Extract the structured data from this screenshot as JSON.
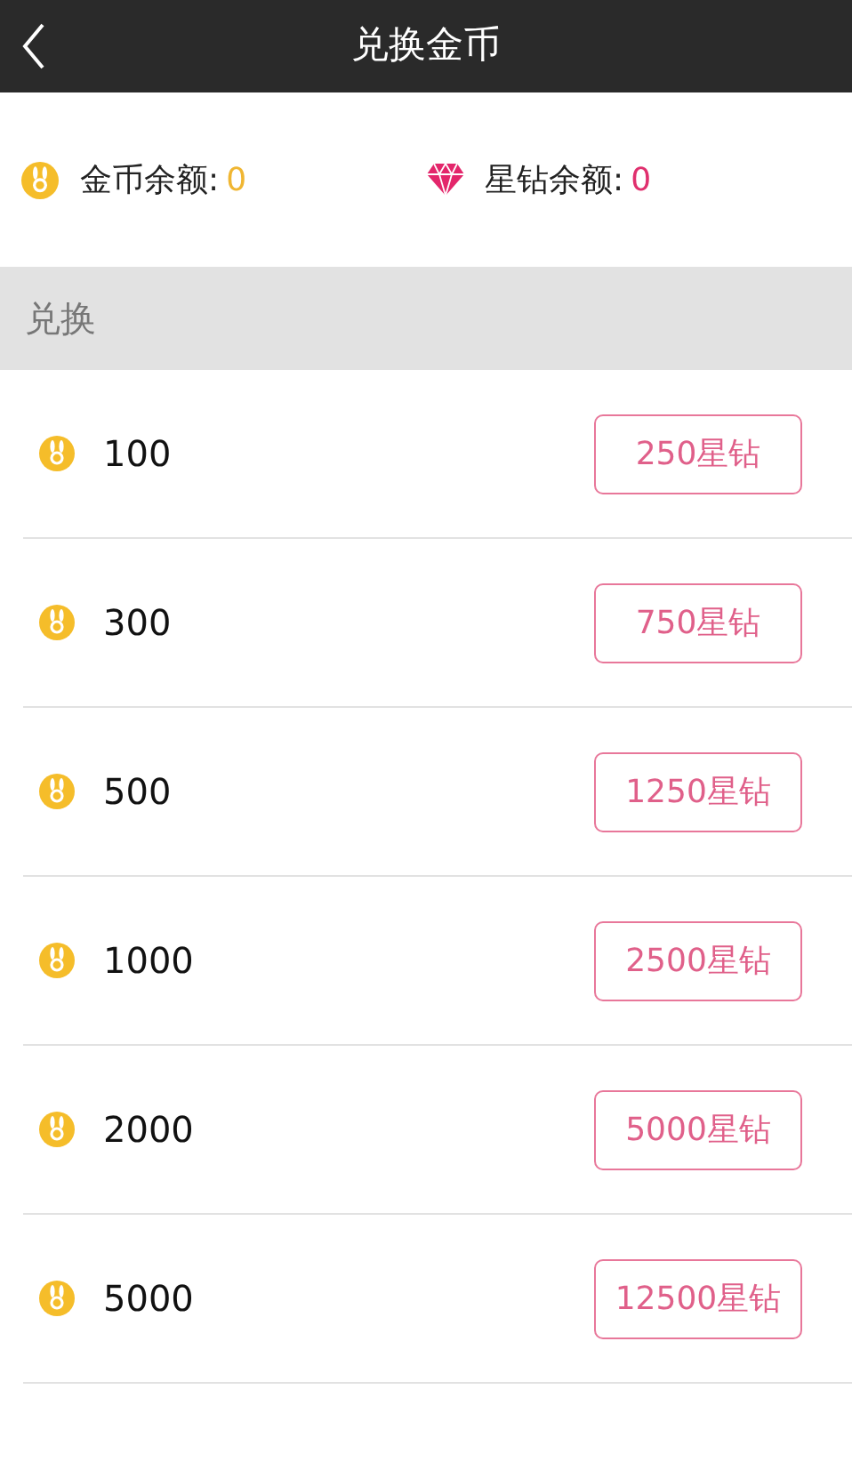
{
  "header": {
    "title": "兑换金币"
  },
  "balances": [
    {
      "kind": "coin",
      "label": "金币余额:",
      "value": "0"
    },
    {
      "kind": "diamond",
      "label": "星钻余额:",
      "value": "0"
    }
  ],
  "section": "兑换",
  "offers": [
    {
      "coins": "100",
      "price": "250星钻"
    },
    {
      "coins": "300",
      "price": "750星钻"
    },
    {
      "coins": "500",
      "price": "1250星钻"
    },
    {
      "coins": "1000",
      "price": "2500星钻"
    },
    {
      "coins": "2000",
      "price": "5000星钻"
    },
    {
      "coins": "5000",
      "price": "12500星钻"
    }
  ]
}
